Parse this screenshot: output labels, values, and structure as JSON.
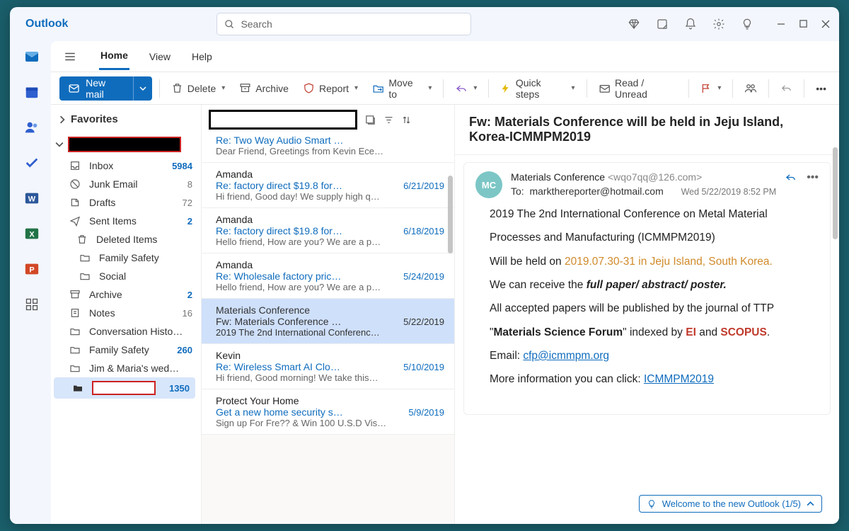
{
  "brand": "Outlook",
  "search_placeholder": "Search",
  "tabs": {
    "home": "Home",
    "view": "View",
    "help": "Help"
  },
  "ribbon": {
    "newmail": "New mail",
    "delete": "Delete",
    "archive": "Archive",
    "report": "Report",
    "moveto": "Move to",
    "quicksteps": "Quick steps",
    "readunread": "Read / Unread"
  },
  "favorites_label": "Favorites",
  "folders": [
    {
      "icon": "inbox",
      "name": "Inbox",
      "count": "5984",
      "bold": true
    },
    {
      "icon": "junk",
      "name": "Junk Email",
      "count": "8",
      "grey": true
    },
    {
      "icon": "draft",
      "name": "Drafts",
      "count": "72",
      "grey": true
    },
    {
      "icon": "sent",
      "name": "Sent Items",
      "count": "2",
      "bold": true
    },
    {
      "icon": "trash",
      "name": "Deleted Items",
      "expandable": true
    },
    {
      "icon": "folder",
      "name": "Family Safety",
      "sub": true
    },
    {
      "icon": "folder",
      "name": "Social",
      "sub": true
    },
    {
      "icon": "archive",
      "name": "Archive",
      "count": "2",
      "bold": true
    },
    {
      "icon": "note",
      "name": "Notes",
      "count": "16",
      "grey": true
    },
    {
      "icon": "folder",
      "name": "Conversation Histo…"
    },
    {
      "icon": "folder",
      "name": "Family Safety",
      "count": "260",
      "bold": true
    },
    {
      "icon": "folder",
      "name": "Jim & Maria's wed…"
    },
    {
      "icon": "fill",
      "name": "",
      "count": "1350",
      "sel": true
    }
  ],
  "messages": [
    {
      "from": "",
      "subject": "Re: Two Way Audio Smart …",
      "date": "",
      "preview": "Dear Friend, Greetings from Kevin Ece…",
      "truncated_top": true
    },
    {
      "from": "Amanda",
      "subject": "Re: factory direct $19.8 for…",
      "date": "6/21/2019",
      "preview": "Hi friend, Good day! We supply high q…"
    },
    {
      "from": "Amanda",
      "subject": "Re: factory direct $19.8 for…",
      "date": "6/18/2019",
      "preview": "Hello friend, How are you? We are a p…"
    },
    {
      "from": "Amanda",
      "subject": "Re: Wholesale factory pric…",
      "date": "5/24/2019",
      "preview": "Hello friend, How are you? We are a p…"
    },
    {
      "from": "Materials Conference",
      "subject": "Fw: Materials Conference …",
      "date": "5/22/2019",
      "preview": "2019 The 2nd International Conferenc…",
      "selected": true
    },
    {
      "from": "Kevin",
      "subject": "Re: Wireless Smart AI Clo…",
      "date": "5/10/2019",
      "preview": "Hi friend, Good morning! We take this…"
    },
    {
      "from": "Protect Your Home",
      "subject": "Get a new home security s…",
      "date": "5/9/2019",
      "preview": "Sign up For Fre?? & Win 100 U.S.D Vis…"
    }
  ],
  "reading": {
    "subject": "Fw: Materials Conference will be held in Jeju Island, Korea-ICMMPM2019",
    "avatar": "MC",
    "sender_name": "Materials Conference",
    "sender_addr": "<wqo7qq@126.com>",
    "to_label": "To:",
    "to": "markthereporter@hotmail.com",
    "date": "Wed 5/22/2019 8:52 PM",
    "line1a": "2019 The 2nd International Conference on Metal Material Processes and Manufacturing (ICMMPM2019)",
    "line2_pre": "Will be held on ",
    "line2_hl": "2019.07.30-31 in Jeju Island, South Korea.",
    "line3_pre": "We can receive the ",
    "line3_b": "full paper/ abstract/ poster.",
    "line4_pre": "All accepted papers will be published by the journal of TTP \"",
    "line4_b": "Materials Science Forum",
    "line4_mid": "\" indexed by ",
    "line4_ei": "EI",
    "line4_and": " and ",
    "line4_sc": "SCOPUS",
    "line4_end": ".",
    "email_lbl": "Email: ",
    "email_link": "cfp@icmmpm.org",
    "more_lbl": "More information you can click: ",
    "more_link": "ICMMPM2019",
    "tip": "Welcome to the new Outlook  (1/5)"
  }
}
